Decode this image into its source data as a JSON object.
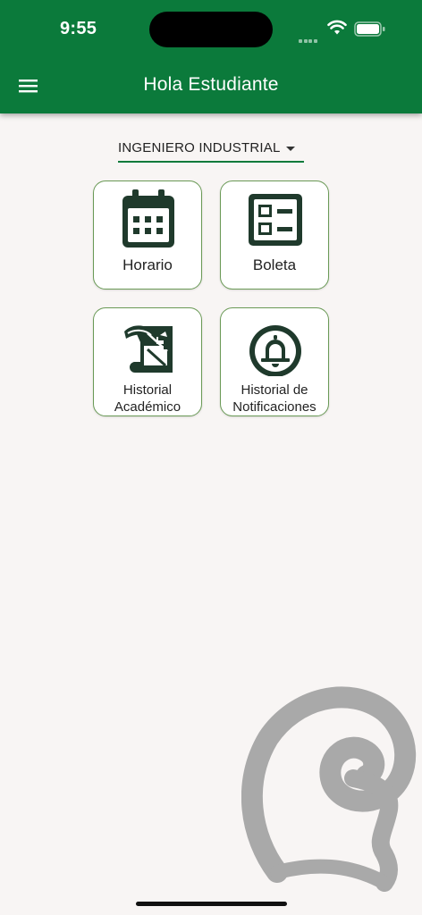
{
  "status_bar": {
    "time": "9:55"
  },
  "app_bar": {
    "title": "Hola Estudiante",
    "menu_icon": "hamburger-menu-icon"
  },
  "career_select": {
    "selected": "INGENIERO INDUSTRIAL"
  },
  "tiles": [
    {
      "label": "Horario",
      "icon": "calendar-icon"
    },
    {
      "label": "Boleta",
      "icon": "checklist-icon"
    },
    {
      "label_line1": "Historial",
      "label_line2": "Académico",
      "icon": "quill-scroll-icon"
    },
    {
      "label_line1": "Historial de",
      "label_line2": "Notificaciones",
      "icon": "bell-icon"
    }
  ],
  "colors": {
    "primary": "#0b7a3b",
    "icon": "#1f3a2c",
    "tile_border": "#6a9a56",
    "background": "#f8f5f4"
  }
}
